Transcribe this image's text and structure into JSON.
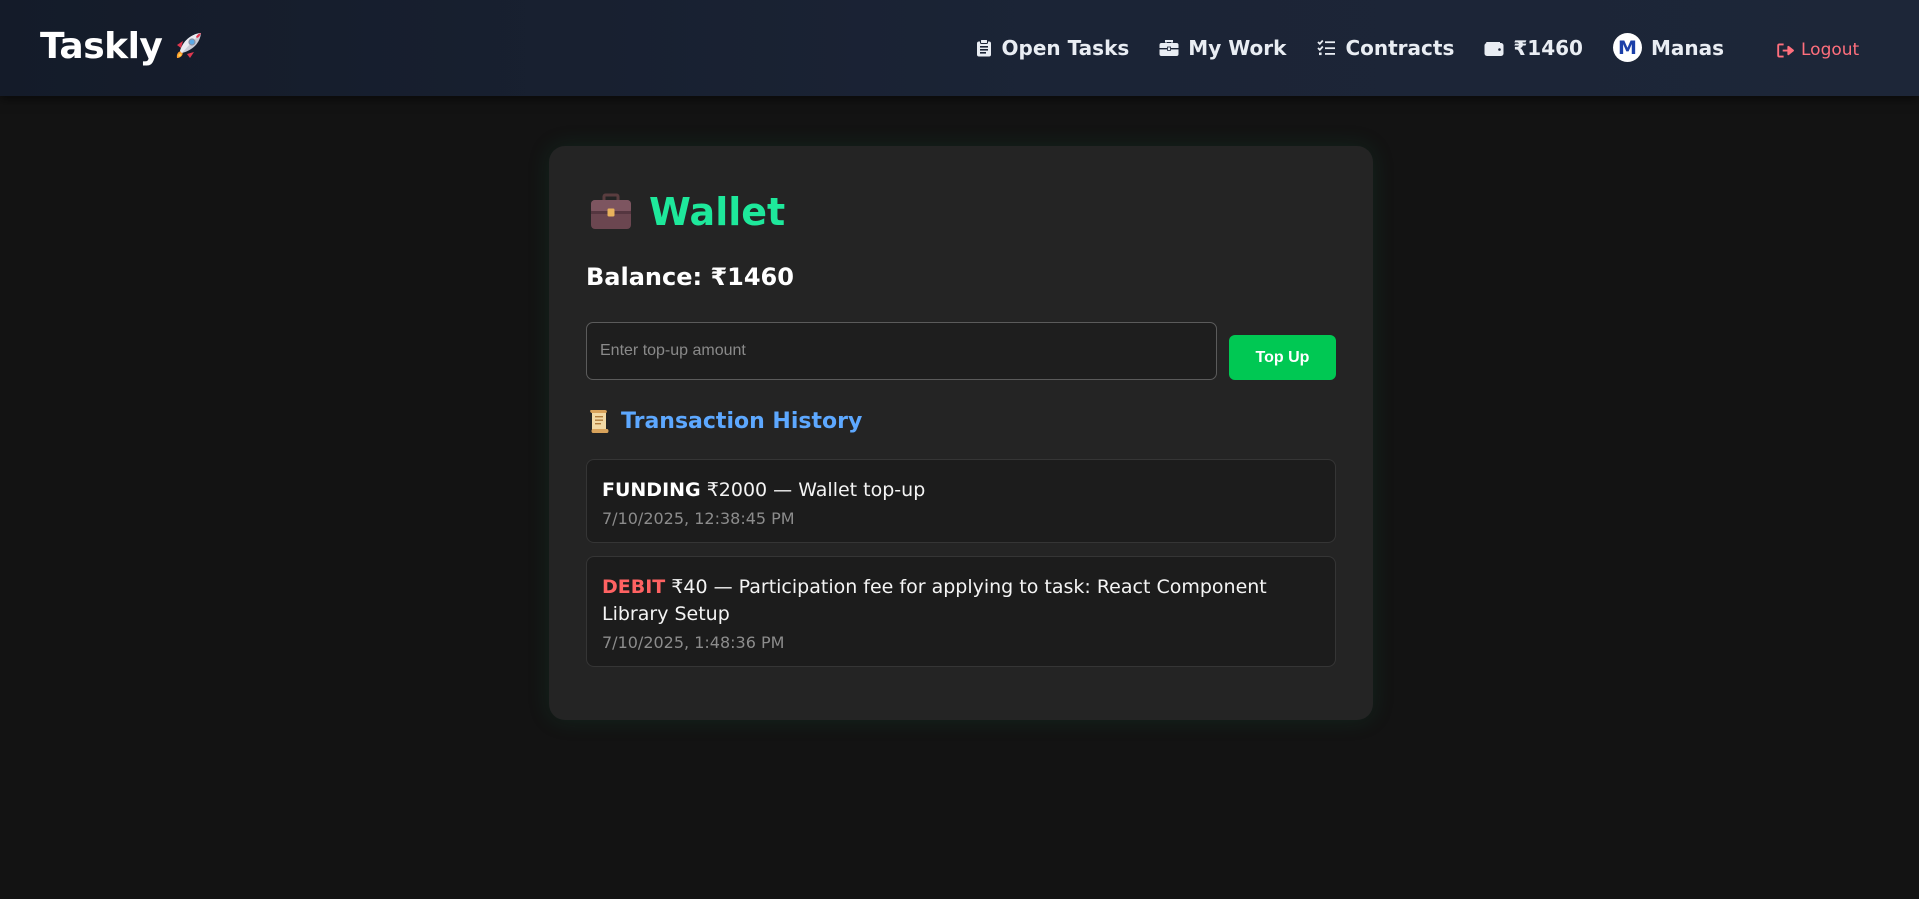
{
  "navbar": {
    "brand": "Taskly",
    "brand_icon": "rocket-icon",
    "links": [
      {
        "label": "Open Tasks",
        "icon": "clipboard-icon"
      },
      {
        "label": "My Work",
        "icon": "briefcase-icon"
      },
      {
        "label": "Contracts",
        "icon": "checklist-icon"
      },
      {
        "label": "₹1460",
        "icon": "wallet-icon"
      }
    ],
    "user": {
      "initial": "M",
      "name": "Manas"
    },
    "logout": {
      "label": "Logout",
      "icon": "logout-icon"
    }
  },
  "wallet": {
    "title": "Wallet",
    "title_icon": "briefcase-icon",
    "balance_text": "Balance: ₹1460",
    "topup": {
      "placeholder": "Enter top-up amount",
      "value": "",
      "button_label": "Top Up"
    },
    "history": {
      "title": "Transaction History",
      "icon": "scroll-icon",
      "transactions": [
        {
          "type": "FUNDING",
          "detail": " ₹2000 — Wallet top-up",
          "date": "7/10/2025, 12:38:45 PM"
        },
        {
          "type": "DEBIT",
          "detail": " ₹40 — Participation fee for applying to task: React Component Library Setup",
          "date": "7/10/2025, 1:48:36 PM"
        }
      ]
    }
  },
  "colors": {
    "accent_green": "#1ee89b",
    "button_green": "#00c853",
    "history_blue": "#5da8ff",
    "debit_red": "#ff6262",
    "logout_red": "#ff6f7d"
  }
}
